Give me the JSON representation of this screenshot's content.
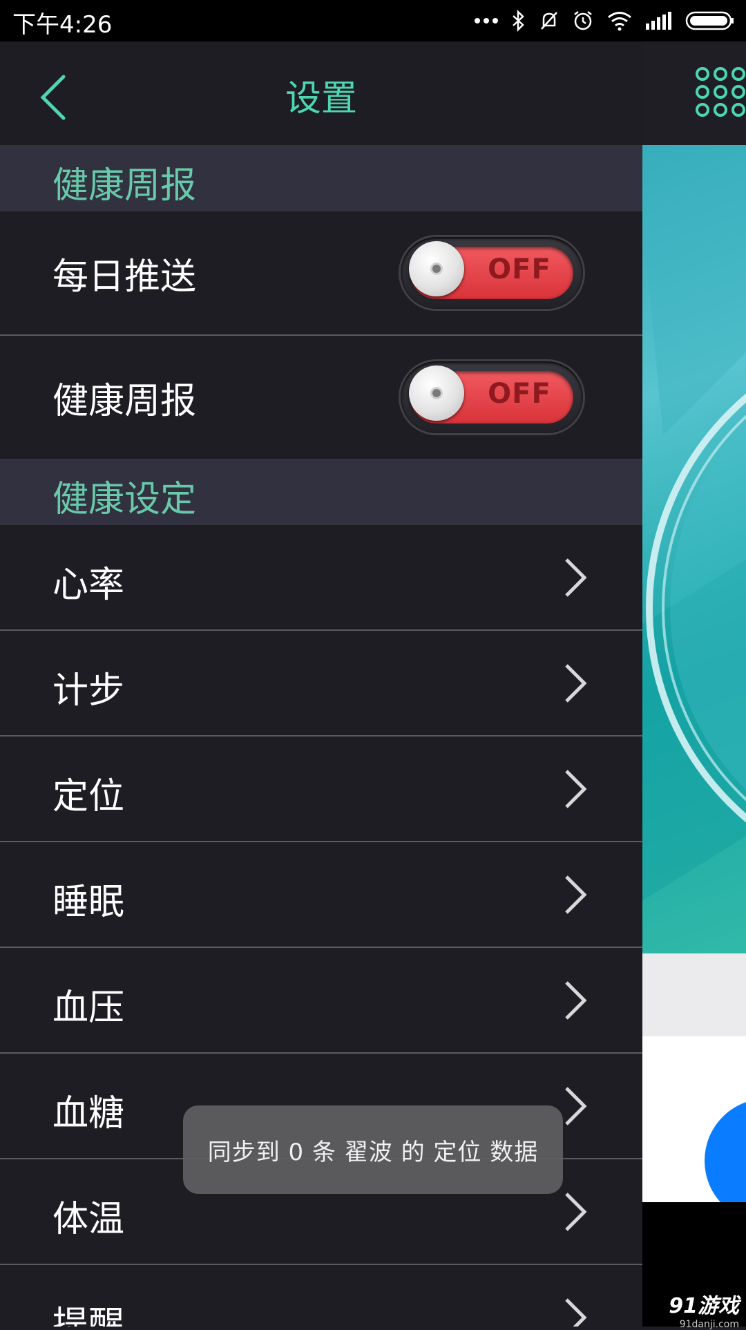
{
  "status_bar": {
    "time": "下午4:26"
  },
  "header": {
    "title": "设置"
  },
  "sections": [
    {
      "title": "健康周报"
    },
    {
      "title": "健康设定"
    }
  ],
  "toggles": [
    {
      "label": "每日推送",
      "state": "OFF"
    },
    {
      "label": "健康周报",
      "state": "OFF"
    }
  ],
  "items": [
    {
      "label": "心率"
    },
    {
      "label": "计步"
    },
    {
      "label": "定位"
    },
    {
      "label": "睡眠"
    },
    {
      "label": "血压"
    },
    {
      "label": "血糖"
    },
    {
      "label": "体温"
    },
    {
      "label": "提醒"
    }
  ],
  "toast": {
    "text": "同步到 0 条 翟波 的 定位 数据"
  },
  "watermark": {
    "brand": "91游戏",
    "url": "91danji.com"
  },
  "colors": {
    "accent": "#4dd6b0",
    "toggle_off": "#e2393f",
    "background": "#1e1d24",
    "section": "#32313f"
  }
}
